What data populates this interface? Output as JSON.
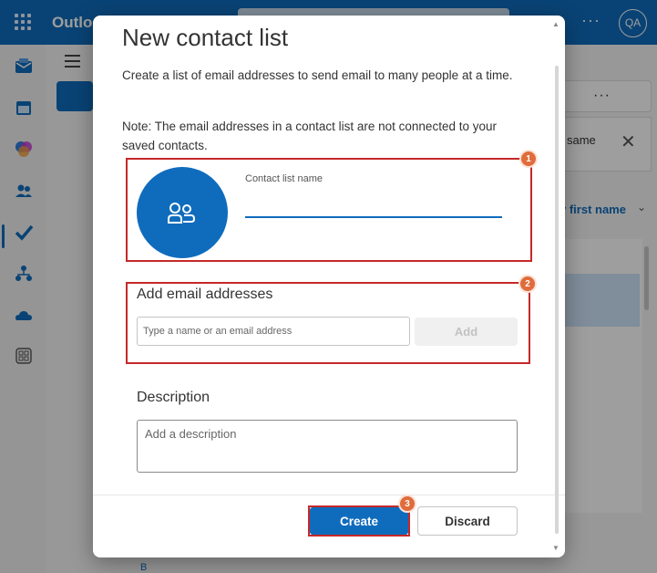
{
  "app": {
    "brand": "Outlo",
    "avatar_initials": "QA"
  },
  "background": {
    "right_card_text": "same",
    "sort_label": "y first name",
    "list_letter": "B"
  },
  "dialog": {
    "title": "New contact list",
    "description": "Create a list of email addresses to send email to many people at a time.",
    "note": "Note: The email addresses in a contact list are not connected to your saved contacts.",
    "name_field": {
      "label": "Contact list name",
      "value": ""
    },
    "add_section": {
      "title": "Add email addresses",
      "placeholder": "Type a name or an email address",
      "add_label": "Add"
    },
    "description_section": {
      "title": "Description",
      "placeholder": "Add a description"
    },
    "buttons": {
      "create": "Create",
      "discard": "Discard"
    }
  },
  "annotations": {
    "badges": [
      "1",
      "2",
      "3"
    ],
    "highlight_color": "#c62828",
    "badge_color": "#e06c3b"
  },
  "colors": {
    "accent": "#0f6cbd"
  },
  "icons": [
    "app-launcher-icon",
    "mail-icon",
    "calendar-icon",
    "copilot-icon",
    "people-icon",
    "todo-icon",
    "org-icon",
    "onedrive-icon",
    "apps-icon",
    "contact-group-icon"
  ]
}
